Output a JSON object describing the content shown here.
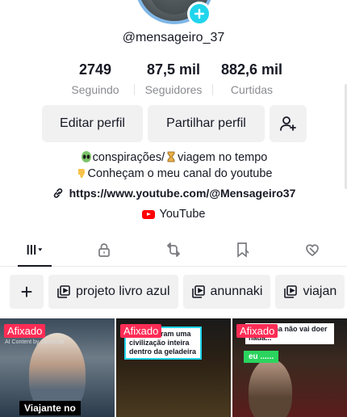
{
  "profile": {
    "username": "@mensageiro_37"
  },
  "stats": [
    {
      "value": "2749",
      "label": "Seguindo"
    },
    {
      "value": "87,5 mil",
      "label": "Seguidores"
    },
    {
      "value": "882,6 mil",
      "label": "Curtidas"
    }
  ],
  "actions": {
    "edit": "Editar perfil",
    "share": "Partilhar perfil"
  },
  "bio": {
    "line1": "conspirações/",
    "line1b": "viagem no tempo",
    "line2": "Conheçam o meu canal do youtube",
    "link": "https://www.youtube.com/@Mensageiro37",
    "youtube": "YouTube"
  },
  "tabs": [
    {
      "icon": "grid-icon",
      "active": true
    },
    {
      "icon": "lock-icon",
      "active": false
    },
    {
      "icon": "repost-icon",
      "active": false
    },
    {
      "icon": "bookmark-icon",
      "active": false
    },
    {
      "icon": "liked-icon",
      "active": false
    }
  ],
  "playlists": [
    {
      "label": "projeto livro azul"
    },
    {
      "label": "anunnaki"
    },
    {
      "label": "viajan"
    }
  ],
  "videos": [
    {
      "pinned": "Afixado",
      "logo": "AI Content by OpusClip",
      "caption": "Viajante no"
    },
    {
      "pinned": "Afixado",
      "overlay": "Encontraram uma civilização inteira dentro da geladeira"
    },
    {
      "pinned": "Afixado",
      "overlay": "picadinha não vai doer nada...",
      "tag": "eu ......"
    }
  ],
  "colors": {
    "accent": "#fe2c55",
    "cyan": "#20d5ec",
    "text": "#161823",
    "muted": "#8a8b91"
  }
}
